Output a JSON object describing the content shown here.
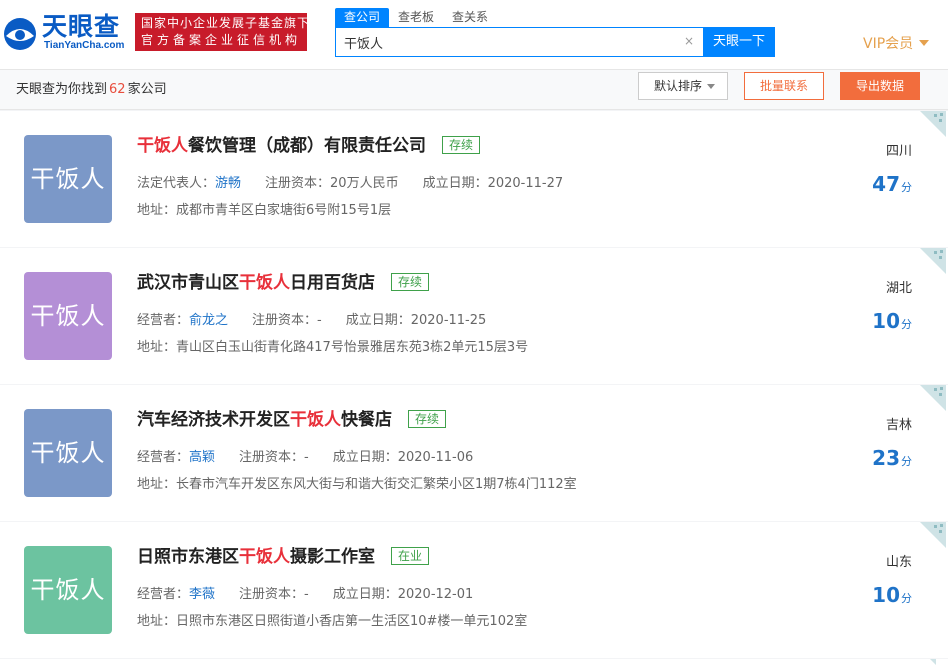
{
  "brand": {
    "logo_title": "天眼查",
    "logo_sub": "TianYanCha.com",
    "badge_line1": "国家中小企业发展子基金旗下",
    "badge_line2": "官方备案企业征信机构"
  },
  "search": {
    "tabs": [
      "查公司",
      "查老板",
      "查关系"
    ],
    "value": "干饭人",
    "button": "天眼一下",
    "clear": "×"
  },
  "vip": "VIP会员",
  "toolbar": {
    "prefix": "天眼查为你找到",
    "count": "62",
    "suffix": "家公司",
    "sort": "默认排序",
    "contact": "批量联系",
    "export": "导出数据"
  },
  "results": [
    {
      "avatar": "干饭人",
      "avatar_color": "#7b98c8",
      "name_pre": "",
      "name_hl": "干饭人",
      "name_post": "餐饮管理（成都）有限责任公司",
      "status": "存续",
      "person_label": "法定代表人：",
      "person": "游畅",
      "capital": "注册资本：20万人民币",
      "date": "成立日期：2020-11-27",
      "address": "地址：成都市青羊区白家塘街6号附15号1层",
      "province": "四川",
      "score": "47",
      "score_unit": "分"
    },
    {
      "avatar": "干饭人",
      "avatar_color": "#b48fd6",
      "name_pre": "武汉市青山区",
      "name_hl": "干饭人",
      "name_post": "日用百货店",
      "status": "存续",
      "person_label": "经营者：",
      "person": "俞龙之",
      "capital": "注册资本：-",
      "date": "成立日期：2020-11-25",
      "address": "地址：青山区白玉山街青化路417号怡景雅居东苑3栋2单元15层3号",
      "province": "湖北",
      "score": "10",
      "score_unit": "分"
    },
    {
      "avatar": "干饭人",
      "avatar_color": "#7b98c8",
      "name_pre": "汽车经济技术开发区",
      "name_hl": "干饭人",
      "name_post": "快餐店",
      "status": "存续",
      "person_label": "经营者：",
      "person": "高颖",
      "capital": "注册资本：-",
      "date": "成立日期：2020-11-06",
      "address": "地址：长春市汽车开发区东风大街与和谐大街交汇繁荣小区1期7栋4门112室",
      "province": "吉林",
      "score": "23",
      "score_unit": "分"
    },
    {
      "avatar": "干饭人",
      "avatar_color": "#6cc3a0",
      "name_pre": "日照市东港区",
      "name_hl": "干饭人",
      "name_post": "摄影工作室",
      "status": "在业",
      "person_label": "经营者：",
      "person": "李薇",
      "capital": "注册资本：-",
      "date": "成立日期：2020-12-01",
      "address": "地址：日照市东港区日照街道小香店第一生活区10#楼一单元102室",
      "province": "山东",
      "score": "10",
      "score_unit": "分"
    }
  ]
}
